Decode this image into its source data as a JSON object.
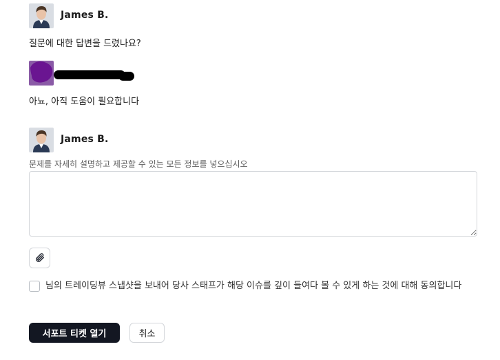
{
  "thread": {
    "messages": [
      {
        "author": "James B.",
        "text": "질문에 대한 답변을 드렸나요?"
      },
      {
        "author": "",
        "text": "아뇨, 아직 도움이 필요합니다"
      }
    ]
  },
  "reply": {
    "author": "James B.",
    "field_label": "문제를 자세히 설명하고 제공할 수 있는 모든 정보를 넣으십시오",
    "textarea_value": "",
    "attach_icon": "paperclip-icon",
    "consent_text": "님의 트레이딩뷰 스냅샷을 보내어 당사 스태프가 해당 이슈를 깊이 들여다 볼 수 있게 하는 것에 대해 동의합니다",
    "consent_checked": false
  },
  "actions": {
    "submit_label": "서포트 티켓 열기",
    "cancel_label": "취소"
  },
  "colors": {
    "primary_button": "#131722",
    "border": "#d3d6da",
    "redaction": "#000000",
    "user_avatar_scribble": "#6a1591"
  }
}
